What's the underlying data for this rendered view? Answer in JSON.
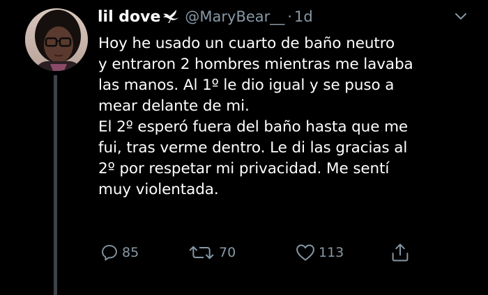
{
  "tweet": {
    "display_name": "lil dove",
    "handle": "@MaryBear__",
    "separator": "·",
    "time": "1d",
    "text": "Hoy he usado un cuarto de baño neutro\ny entraron 2 hombres mientras me lavaba\nlas manos. Al 1º le dio igual y se puso a\nmear delante de mi.\nEl 2º esperó fuera del baño hasta que me\nfui, tras verme dentro. Le di las gracias al\n2º por respetar mi privacidad. Me sentí\nmuy violentada.",
    "actions": {
      "reply_count": "85",
      "retweet_count": "70",
      "like_count": "113"
    },
    "icons": {
      "name_emoji": "dove-emoji",
      "menu": "chevron-down-icon",
      "reply": "reply-icon",
      "retweet": "retweet-icon",
      "like": "heart-icon",
      "share": "share-icon"
    },
    "colors": {
      "background": "#000000",
      "text": "#ffffff",
      "secondary": "#8899a6",
      "thread_line": "#3d4148"
    }
  }
}
